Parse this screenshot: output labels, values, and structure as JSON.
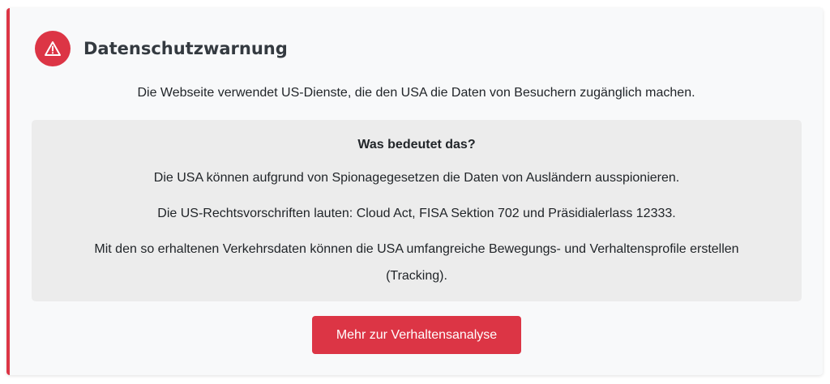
{
  "warning": {
    "icon": "warning-triangle-icon",
    "accent_color": "#dc3545",
    "title": "Datenschutzwarnung",
    "intro": "Die Webseite verwendet US-Dienste, die den USA die Daten von Besuchern zugänglich machen.",
    "info": {
      "question": "Was bedeutet das?",
      "paragraphs": [
        "Die USA können aufgrund von Spionagegesetzen die Daten von Ausländern ausspionieren.",
        "Die US-Rechtsvorschriften lauten: Cloud Act, FISA Sektion 702 und Präsidialerlass 12333.",
        "Mit den so erhaltenen Verkehrsdaten können die USA umfangreiche Bewegungs- und Verhaltensprofile erstellen (Tracking)."
      ]
    },
    "button_label": "Mehr zur Verhaltensanalyse"
  }
}
